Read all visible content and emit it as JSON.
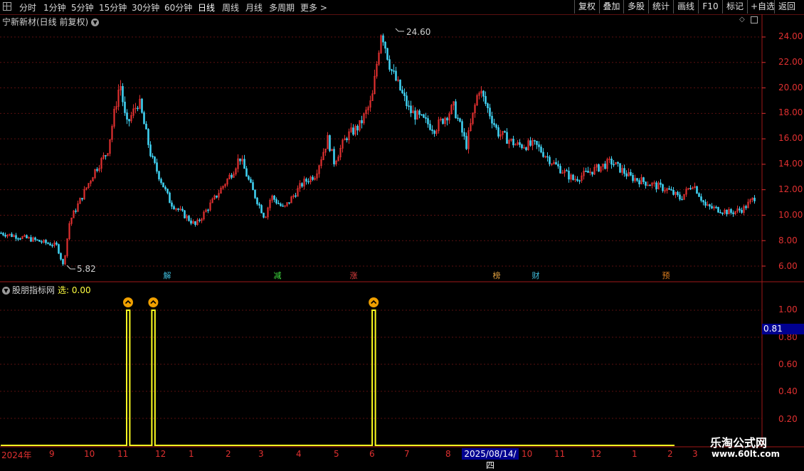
{
  "toolbar": {
    "periods": [
      "分时",
      "1分钟",
      "5分钟",
      "15分钟",
      "30分钟",
      "60分钟",
      "日线",
      "周线",
      "月线",
      "多周期",
      "更多 >"
    ],
    "active_period": "日线",
    "right_buttons": [
      "复权",
      "叠加",
      "多股",
      "统计",
      "画线",
      "F10",
      "标记",
      "+自选",
      "返回"
    ]
  },
  "stock": {
    "title": "宁新新材(日线 前复权)",
    "high_label": "24.60",
    "low_label": "5.82"
  },
  "indicator": {
    "name": "股朋指标网",
    "select_label": "选: 0.00",
    "current_value": "0.81"
  },
  "events": [
    {
      "label": "解",
      "color": "#40c0e0"
    },
    {
      "label": "减",
      "color": "#40e040"
    },
    {
      "label": "涨",
      "color": "#e04040"
    },
    {
      "label": "榜",
      "color": "#e0a040"
    },
    {
      "label": "财",
      "color": "#40c0e0"
    },
    {
      "label": "预",
      "color": "#e08020"
    }
  ],
  "price_axis": [
    "24.00",
    "22.00",
    "20.00",
    "18.00",
    "16.00",
    "14.00",
    "12.00",
    "10.00",
    "8.00",
    "6.00"
  ],
  "indicator_axis": [
    "1.00",
    "0.80",
    "0.60",
    "0.40",
    "0.20"
  ],
  "x_axis": [
    "2024年",
    "9",
    "10",
    "11",
    "12",
    "1",
    "2",
    "3",
    "4",
    "5",
    "6",
    "7",
    "8",
    "10",
    "11",
    "12",
    "1",
    "2",
    "3"
  ],
  "cursor_date": "2025/08/14/四",
  "watermark": {
    "line1": "乐淘公式网",
    "line2": "www.60lt.com"
  },
  "colors": {
    "up": "#e03030",
    "down": "#40d0f0",
    "grid": "#5a1010",
    "signal": "#ffff20",
    "axis": "#e03030"
  },
  "chart_data": [
    {
      "type": "candlestick",
      "title": "宁新新材(日线 前复权)",
      "ylim": [
        5.0,
        25.5
      ],
      "ticks": [
        6,
        8,
        10,
        12,
        14,
        16,
        18,
        20,
        22,
        24
      ],
      "close_path_t_price": [
        [
          0,
          8.6
        ],
        [
          0.05,
          8.1
        ],
        [
          0.09,
          7.6
        ],
        [
          0.1,
          6.0
        ],
        [
          0.11,
          9.5
        ],
        [
          0.13,
          11.5
        ],
        [
          0.15,
          13.5
        ],
        [
          0.17,
          15.0
        ],
        [
          0.19,
          20.5
        ],
        [
          0.2,
          17.0
        ],
        [
          0.22,
          19.0
        ],
        [
          0.24,
          14.5
        ],
        [
          0.27,
          11.0
        ],
        [
          0.31,
          9.2
        ],
        [
          0.34,
          11.3
        ],
        [
          0.37,
          13.5
        ],
        [
          0.38,
          14.6
        ],
        [
          0.4,
          12.0
        ],
        [
          0.42,
          9.8
        ],
        [
          0.43,
          11.5
        ],
        [
          0.45,
          10.5
        ],
        [
          0.48,
          12.5
        ],
        [
          0.5,
          13.2
        ],
        [
          0.52,
          16.0
        ],
        [
          0.53,
          14.2
        ],
        [
          0.55,
          16.2
        ],
        [
          0.57,
          17.0
        ],
        [
          0.59,
          19.0
        ],
        [
          0.605,
          24.6
        ],
        [
          0.62,
          21.5
        ],
        [
          0.65,
          18.2
        ],
        [
          0.69,
          16.8
        ],
        [
          0.72,
          18.5
        ],
        [
          0.74,
          15.5
        ],
        [
          0.76,
          20.0
        ],
        [
          0.79,
          16.5
        ],
        [
          0.82,
          15.5
        ],
        [
          0.85,
          15.5
        ],
        [
          0.88,
          14.0
        ],
        [
          0.91,
          12.8
        ],
        [
          0.94,
          13.5
        ],
        [
          0.97,
          14.2
        ],
        [
          1.0,
          13.0
        ],
        [
          1.03,
          12.5
        ],
        [
          1.06,
          12.0
        ],
        [
          1.08,
          11.3
        ],
        [
          1.1,
          12.5
        ],
        [
          1.12,
          10.7
        ],
        [
          1.16,
          10.2
        ],
        [
          1.18,
          10.5
        ],
        [
          1.2,
          11.5
        ]
      ]
    },
    {
      "type": "line",
      "title": "股朋指标网",
      "ylim": [
        0,
        1.2
      ],
      "ticks": [
        0.2,
        0.4,
        0.6,
        0.8,
        1.0
      ],
      "series": [
        {
          "values": [
            [
              0,
              0
            ],
            [
              0.2,
              0
            ],
            [
              0.2,
              1
            ],
            [
              0.205,
              1
            ],
            [
              0.205,
              0
            ],
            [
              0.24,
              0
            ],
            [
              0.24,
              1
            ],
            [
              0.245,
              1
            ],
            [
              0.245,
              0
            ],
            [
              0.59,
              0
            ],
            [
              0.59,
              1
            ],
            [
              0.595,
              1
            ],
            [
              0.595,
              0
            ],
            [
              1.07,
              0
            ]
          ]
        }
      ]
    }
  ]
}
